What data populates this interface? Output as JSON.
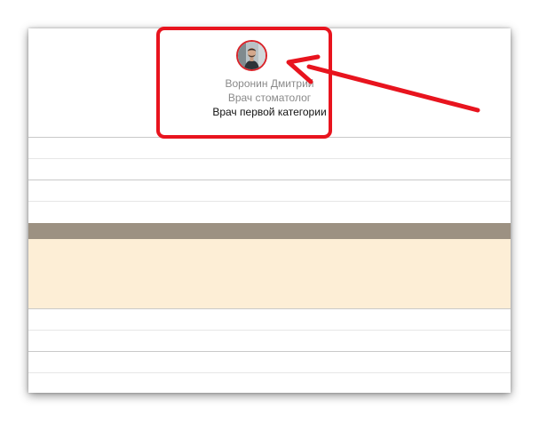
{
  "doctor": {
    "name": "Воронин Дмитрий",
    "specialty": "Врач стоматолог",
    "category": "Врач первой категории",
    "avatar_icon": "person-photo-icon"
  },
  "annotation": {
    "color": "#e8141e"
  },
  "colors": {
    "header_band": "#9c9182",
    "highlight_band": "#fdeed6"
  }
}
